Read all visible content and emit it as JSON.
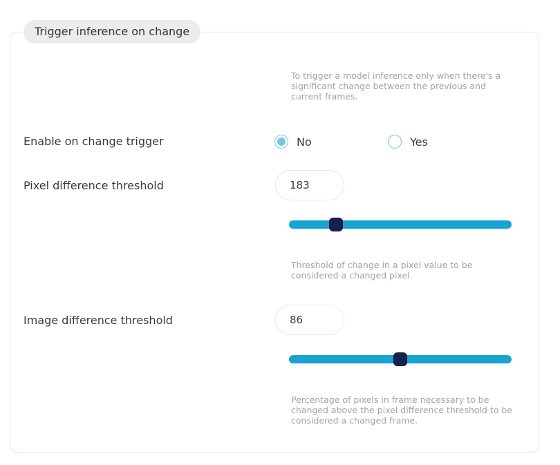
{
  "section": {
    "legend": "Trigger inference on change",
    "description": "To trigger a model inference only when there's a significant change between the previous and current frames."
  },
  "enable_trigger": {
    "label": "Enable on change trigger",
    "options": [
      {
        "label": "No",
        "selected": true
      },
      {
        "label": "Yes",
        "selected": false
      }
    ]
  },
  "pixel_threshold": {
    "label": "Pixel difference threshold",
    "value": "183",
    "slider_fraction": 0.21,
    "help": "Threshold of change in a pixel value to be considered a changed pixel."
  },
  "image_threshold": {
    "label": "Image difference threshold",
    "value": "86",
    "slider_fraction": 0.5,
    "help": "Percentage of pixels in frame necessary to be changed above the pixel difference threshold to be considered a changed frame."
  },
  "colors": {
    "accent": "#18a3d2",
    "thumb": "#15224e",
    "radio": "#76c5de",
    "help_text": "#a3a3a3"
  }
}
